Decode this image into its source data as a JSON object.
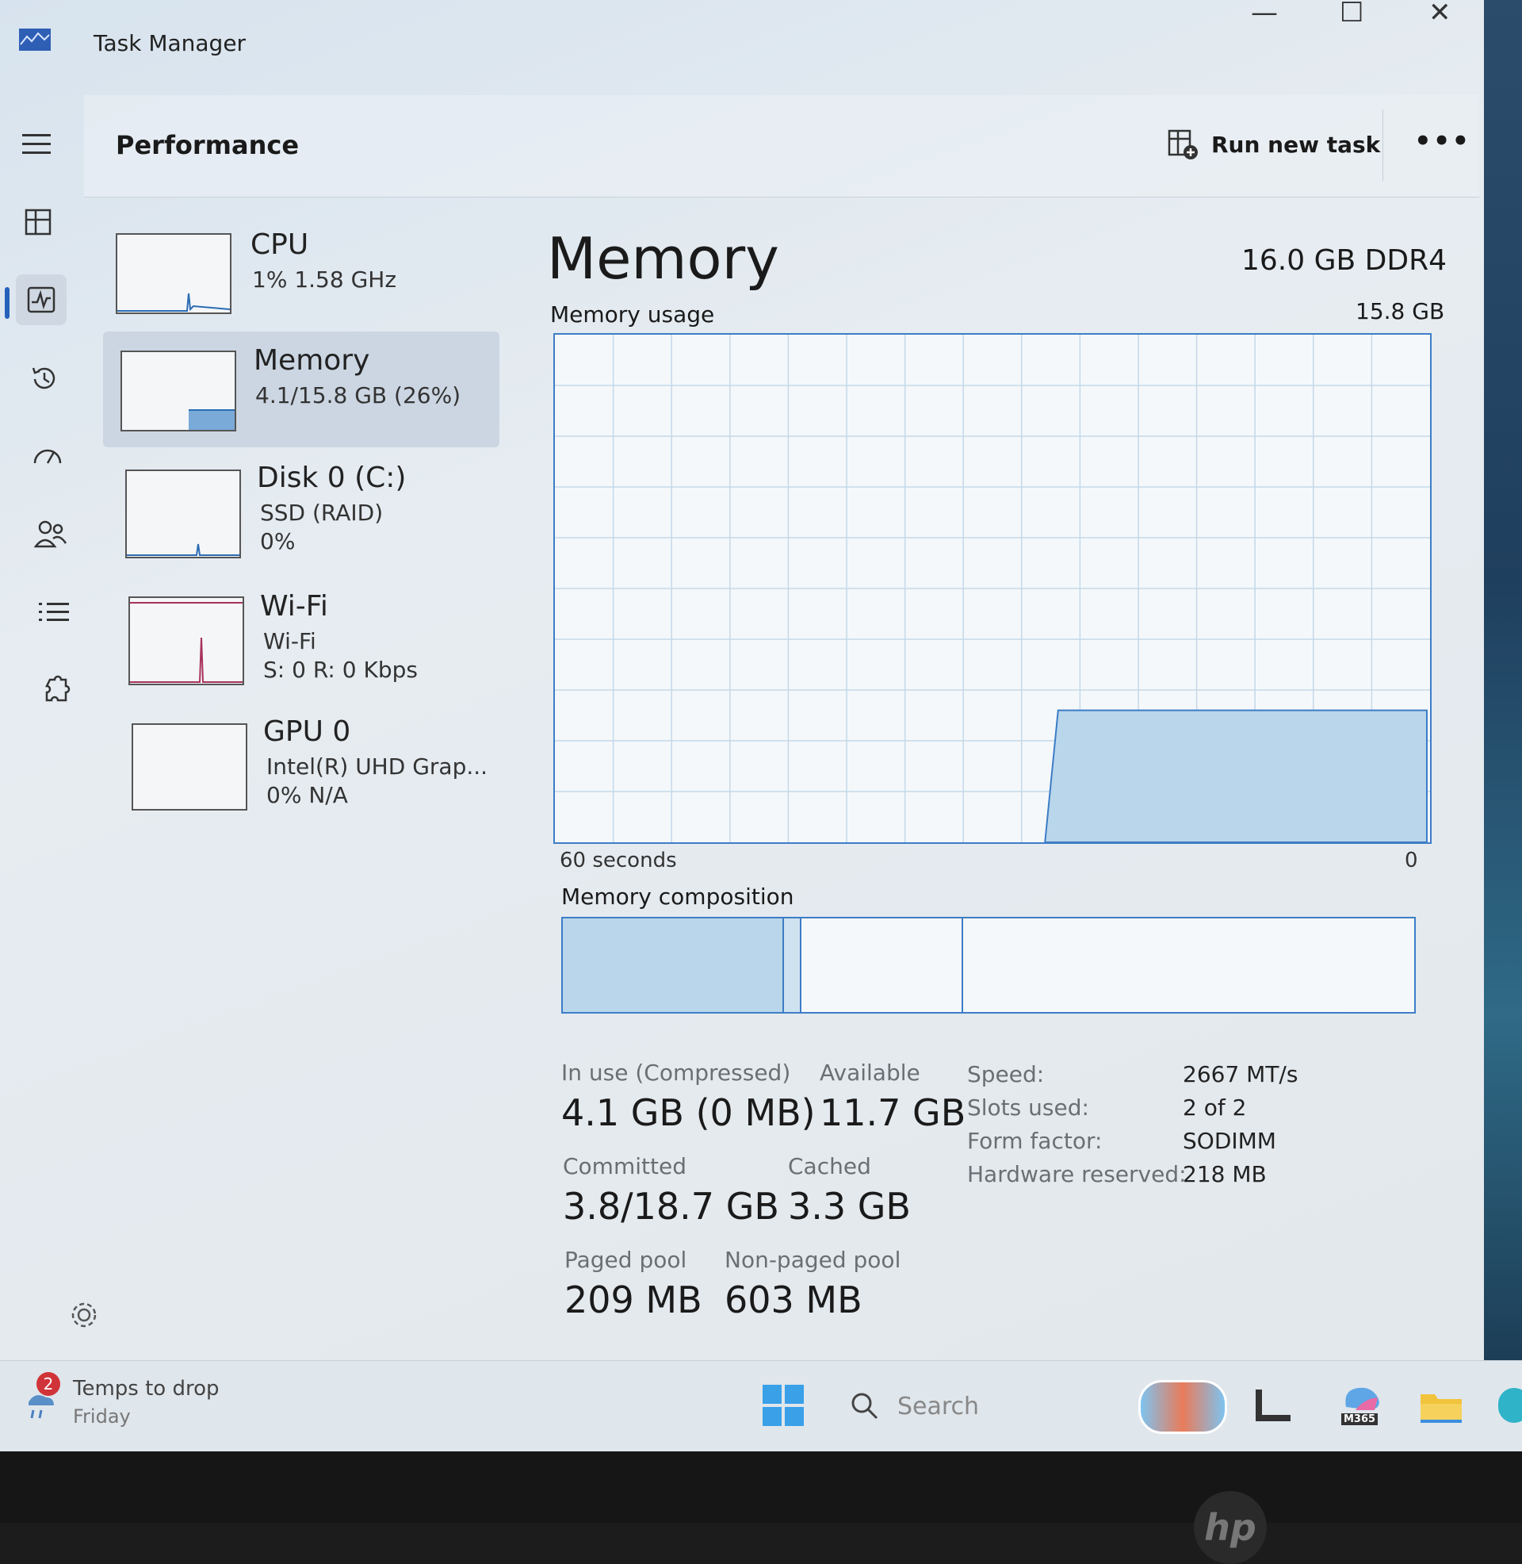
{
  "window": {
    "title": "Task Manager",
    "minimize": "—",
    "maximize": "☐",
    "close": "✕"
  },
  "header": {
    "page_title": "Performance",
    "run_new_task": "Run new task",
    "more": "•••"
  },
  "devices": [
    {
      "name": "CPU",
      "sub1": "1% 1.58 GHz",
      "sub2": ""
    },
    {
      "name": "Memory",
      "sub1": "4.1/15.8 GB (26%)",
      "sub2": ""
    },
    {
      "name": "Disk 0 (C:)",
      "sub1": "SSD (RAID)",
      "sub2": "0%"
    },
    {
      "name": "Wi-Fi",
      "sub1": "Wi-Fi",
      "sub2": "S: 0 R: 0 Kbps"
    },
    {
      "name": "GPU 0",
      "sub1": "Intel(R) UHD Grap...",
      "sub2": "0% N/A"
    }
  ],
  "main": {
    "title": "Memory",
    "spec": "16.0 GB DDR4",
    "usage_label": "Memory usage",
    "usage_max": "15.8 GB",
    "x_left": "60 seconds",
    "x_right": "0",
    "composition_label": "Memory composition",
    "usage_fraction": 0.26
  },
  "composition": {
    "in_use_fraction": 0.26,
    "modified_fraction": 0.02,
    "standby_fraction": 0.19,
    "free_fraction": 0.53
  },
  "stats": {
    "in_use_label": "In use (Compressed)",
    "in_use_value": "4.1 GB (0 MB)",
    "available_label": "Available",
    "available_value": "11.7 GB",
    "committed_label": "Committed",
    "committed_value": "3.8/18.7 GB",
    "cached_label": "Cached",
    "cached_value": "3.3 GB",
    "paged_label": "Paged pool",
    "paged_value": "209 MB",
    "nonpaged_label": "Non-paged pool",
    "nonpaged_value": "603 MB"
  },
  "specs": [
    {
      "key": "Speed:",
      "value": "2667 MT/s"
    },
    {
      "key": "Slots used:",
      "value": "2 of 2"
    },
    {
      "key": "Form factor:",
      "value": "SODIMM"
    },
    {
      "key": "Hardware reserved:",
      "value": "218 MB"
    }
  ],
  "taskbar": {
    "weather_badge": "2",
    "weather_title": "Temps to drop",
    "weather_sub": "Friday",
    "search_placeholder": "Search",
    "m365_label": "M365",
    "brand": "hp"
  },
  "colors": {
    "accent": "#3d7dc7",
    "graph_fill": "#b9d6ea",
    "selected_bg": "#cbd6e2"
  }
}
